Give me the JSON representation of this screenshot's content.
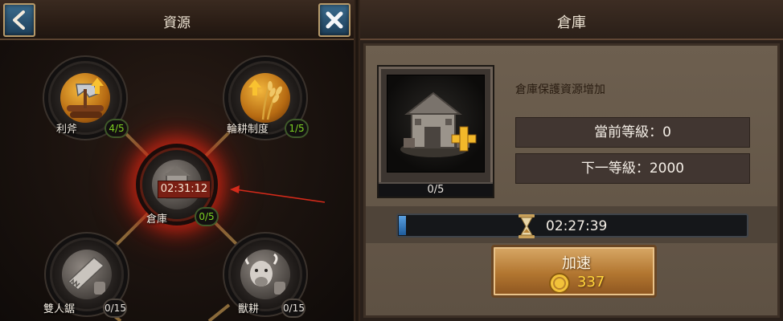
{
  "left_panel": {
    "title": "資源",
    "nodes": [
      {
        "key": "axe",
        "label": "利斧",
        "count": "4/5",
        "count_color": "#7ed321",
        "icon": "axe-logs-icon"
      },
      {
        "key": "rotation",
        "label": "輪耕制度",
        "count": "1/5",
        "count_color": "#7ed321",
        "icon": "wheat-icon"
      },
      {
        "key": "warehouse",
        "label": "倉庫",
        "count": "0/5",
        "count_color": "#7ed321",
        "timer": "02:31:12",
        "icon": "warehouse-icon"
      },
      {
        "key": "saw",
        "label": "雙人鋸",
        "count": "0/15",
        "count_color": "#e9e4de",
        "icon": "saw-icon"
      },
      {
        "key": "ox",
        "label": "獸耕",
        "count": "0/15",
        "count_color": "#e9e4de",
        "icon": "ox-icon"
      }
    ]
  },
  "right_panel": {
    "title": "倉庫",
    "description": "倉庫保護資源增加",
    "building_progress": "0/5",
    "current_level": "當前等級：0",
    "next_level": "下一等級：2000",
    "research_timer": "02:27:39",
    "timer_progress": 0.02,
    "speed_up_label": "加速",
    "speed_up_cost": "337"
  },
  "colors": {
    "active_glow": "#dc2814",
    "gold": "#f2b63c",
    "count_green": "#7ed321",
    "timer_fill": "#5aa0e0",
    "cost_yellow": "#ffd43a"
  }
}
